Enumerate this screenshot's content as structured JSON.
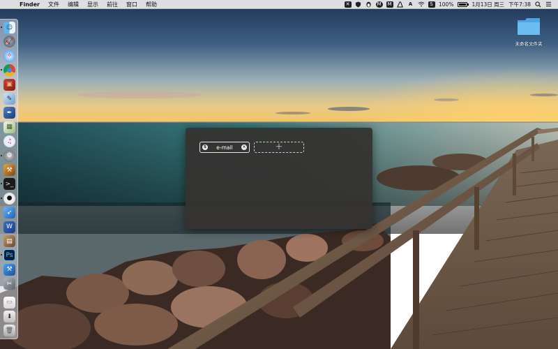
{
  "menubar": {
    "app_name": "Finder",
    "menus": [
      "文件",
      "编辑",
      "显示",
      "前往",
      "窗口",
      "帮助"
    ],
    "status_icons": [
      "x-icon",
      "shield-icon",
      "qq-penguin-icon",
      "m-circle-icon",
      "m-square-icon",
      "adobe-icon",
      "a-text-icon",
      "wifi-icon",
      "s-icon"
    ],
    "battery_percent_label": "100%",
    "battery_level": 1.0,
    "date": "1月13日 周三",
    "time": "下午7:38"
  },
  "dock": {
    "apps": [
      "finder",
      "launchpad",
      "safari",
      "chrome",
      "sketchup",
      "photo-viewer",
      "pen-tool",
      "preview",
      "itunes",
      "system-preferences",
      "robot-app",
      "terminal",
      "qq",
      "bird-app",
      "word",
      "photo-app",
      "photoshop",
      "xcode",
      "tools-app",
      "documents",
      "downloads",
      "trash"
    ]
  },
  "desktop": {
    "folder_label": "未命名文件夹"
  },
  "panel": {
    "tag_label": "e-mail",
    "tag_left_icon_glyph": "$",
    "tag_right_icon_glyph": "×",
    "add_glyph": "+"
  },
  "colors": {
    "panel_bg": "#343230",
    "folder": "#5fb4ec",
    "sky_top": "#20375a",
    "sunset": "#f6c86a"
  }
}
